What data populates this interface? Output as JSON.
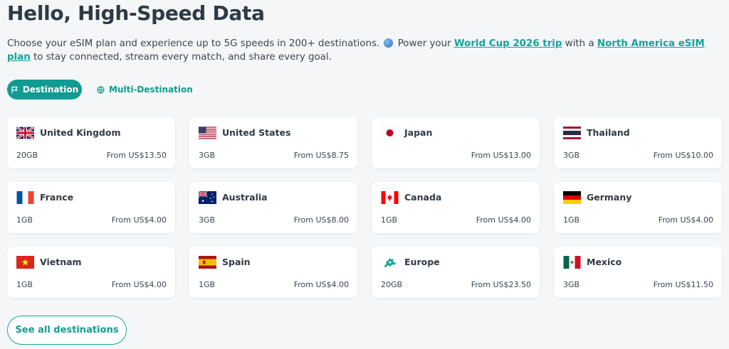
{
  "title": "Hello, High-Speed Data",
  "subtitle": {
    "part1": "Choose your eSIM plan and experience up to 5G speeds in 200+ destinations. ",
    "part2": " Power your ",
    "link1": "World Cup 2026 trip",
    "part3": " with a ",
    "link2": "North America eSIM plan",
    "part4": " to stay connected, stream every match, and share every goal."
  },
  "tabs": {
    "destination": "Destination",
    "multi": "Multi-Destination"
  },
  "cards": [
    {
      "country": "United Kingdom",
      "data": "20GB",
      "price": "From US$13.50",
      "flag": "uk"
    },
    {
      "country": "United States",
      "data": "3GB",
      "price": "From US$8.75",
      "flag": "us"
    },
    {
      "country": "Japan",
      "data": "",
      "price": "From US$13.00",
      "flag": "jp"
    },
    {
      "country": "Thailand",
      "data": "3GB",
      "price": "From US$10.00",
      "flag": "th"
    },
    {
      "country": "France",
      "data": "1GB",
      "price": "From US$4.00",
      "flag": "fr"
    },
    {
      "country": "Australia",
      "data": "3GB",
      "price": "From US$8.00",
      "flag": "au"
    },
    {
      "country": "Canada",
      "data": "1GB",
      "price": "From US$4.00",
      "flag": "ca"
    },
    {
      "country": "Germany",
      "data": "1GB",
      "price": "From US$4.00",
      "flag": "de"
    },
    {
      "country": "Vietnam",
      "data": "1GB",
      "price": "From US$4.00",
      "flag": "vn"
    },
    {
      "country": "Spain",
      "data": "1GB",
      "price": "From US$4.00",
      "flag": "es"
    },
    {
      "country": "Europe",
      "data": "20GB",
      "price": "From US$23.50",
      "flag": "eu"
    },
    {
      "country": "Mexico",
      "data": "3GB",
      "price": "From US$11.50",
      "flag": "mx"
    }
  ],
  "see_all": "See all destinations",
  "colors": {
    "accent": "#0f9c92",
    "background": "#f4f6f7"
  }
}
